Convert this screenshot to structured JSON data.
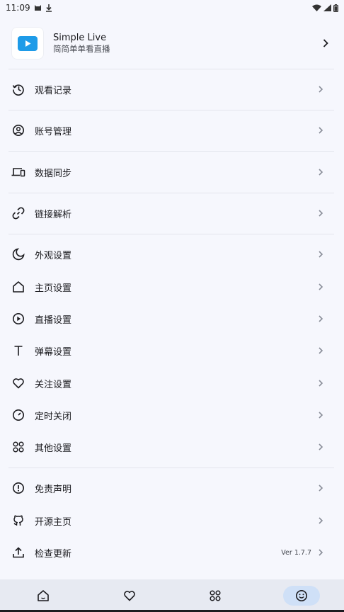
{
  "status_bar": {
    "time": "11:09",
    "left_icons": [
      "cat-notification-icon",
      "download-icon"
    ],
    "right_icons": [
      "wifi-icon",
      "signal-icon",
      "battery-icon"
    ]
  },
  "profile": {
    "name": "Simple Live",
    "subtitle": "简简单单看直播",
    "logo_icon": "play-logo-icon",
    "accent_color": "#1e9be8"
  },
  "menu": {
    "history": "观看记录",
    "account": "账号管理",
    "sync": "数据同步",
    "link_parse": "链接解析",
    "appearance": "外观设置",
    "home_settings": "主页设置",
    "live_settings": "直播设置",
    "danmaku_settings": "弹幕设置",
    "follow_settings": "关注设置",
    "timer_close": "定时关闭",
    "other_settings": "其他设置",
    "disclaimer": "免责声明",
    "open_source": "开源主页",
    "check_update": "检查更新",
    "version": "Ver 1.7.7"
  },
  "bottom_nav": {
    "items": [
      "home-icon",
      "heart-icon",
      "apps-icon",
      "smile-icon"
    ],
    "active_index": 3,
    "active_bg": "#cfe0f7"
  }
}
